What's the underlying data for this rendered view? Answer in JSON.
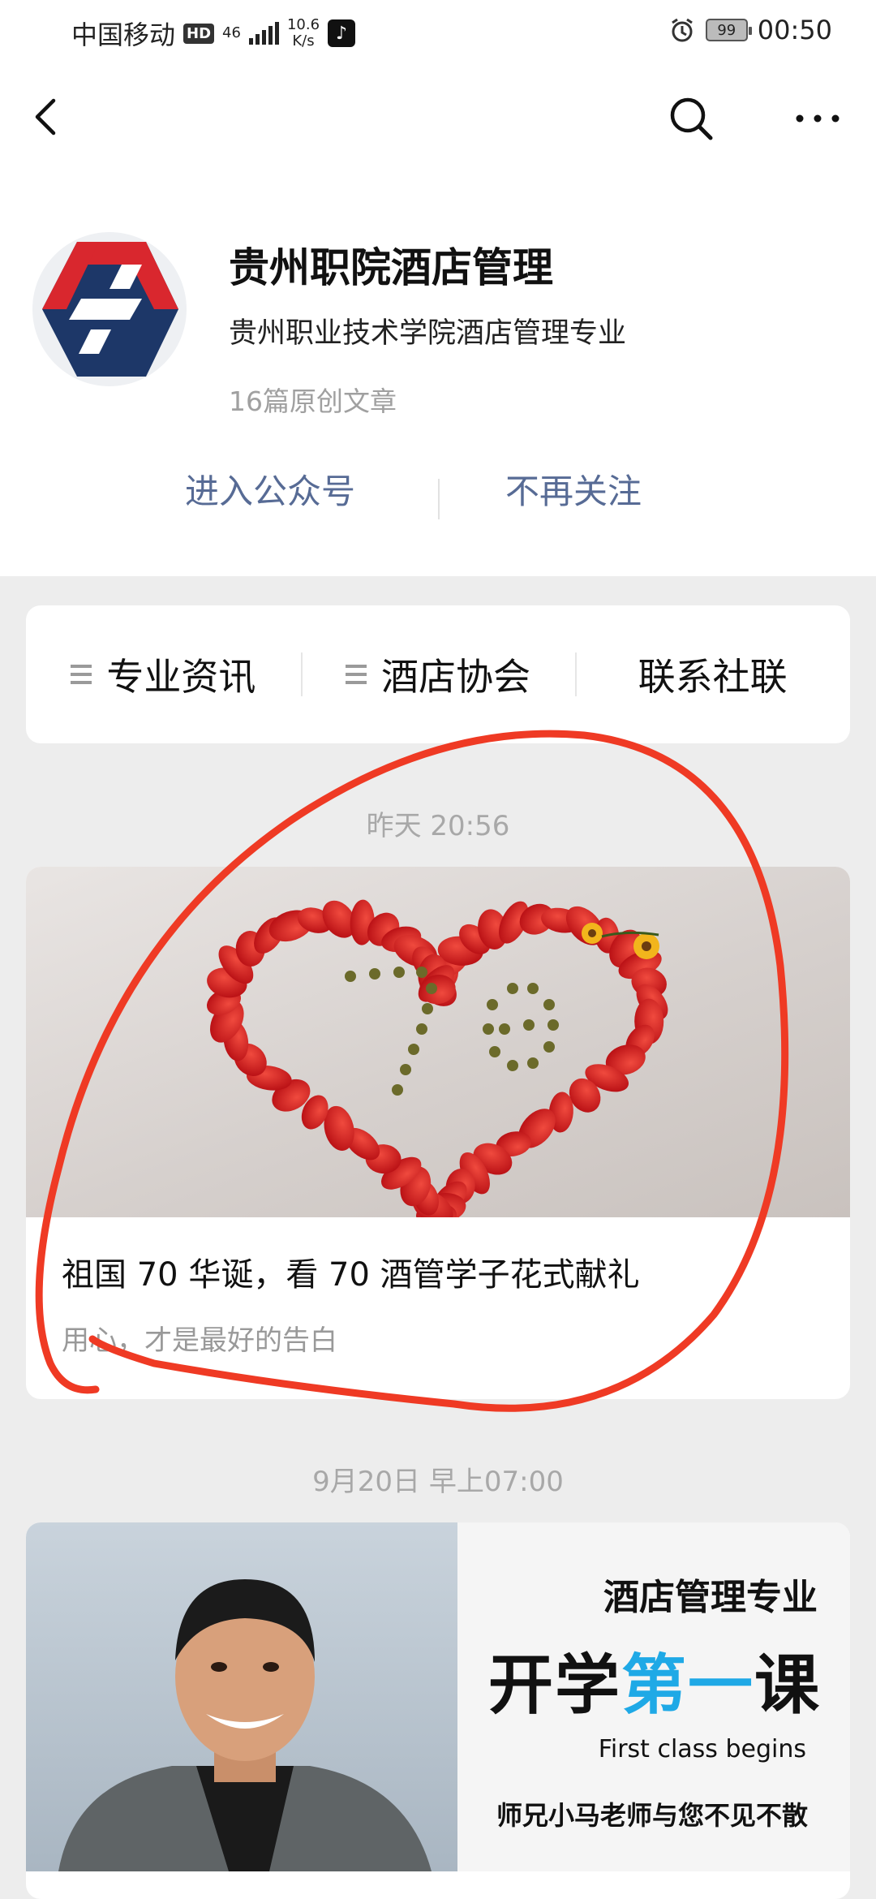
{
  "status": {
    "carrier": "中国移动",
    "hd": "HD",
    "net_type": "46",
    "speed_value": "10.6",
    "speed_unit": "K/s",
    "battery": "99",
    "time": "00:50",
    "icons": [
      "hd-icon",
      "signal-icon",
      "tiktok-icon",
      "alarm-icon",
      "battery-icon"
    ]
  },
  "nav": {
    "icons": [
      "back-arrow-icon",
      "search-icon",
      "more-icon"
    ]
  },
  "profile": {
    "name": "贵州职院酒店管理",
    "description": "贵州职业技术学院酒店管理专业",
    "article_count": "16篇原创文章",
    "enter_label": "进入公众号",
    "unfollow_label": "不再关注",
    "logo_colors": {
      "red": "#d9272e",
      "navy": "#1d3768"
    }
  },
  "menu": {
    "items": [
      {
        "label": "专业资讯",
        "has_list_icon": true
      },
      {
        "label": "酒店协会",
        "has_list_icon": true
      },
      {
        "label": "联系社联",
        "has_list_icon": false
      }
    ]
  },
  "feed": [
    {
      "timestamp": "昨天 20:56",
      "title": "祖国 70 华诞，看 70 酒管学子花式献礼",
      "subtitle": "用心，才是最好的告白",
      "cover_text": "70"
    },
    {
      "timestamp": "9月20日 早上07:00",
      "cover_heading": "酒店管理专业",
      "cover_title_part1": "开学",
      "cover_title_accent": "第一",
      "cover_title_part2": "课",
      "cover_english": "First class begins",
      "cover_footer": "师兄小马老师与您不见不散",
      "accent_color": "#1fa9e6"
    }
  ],
  "annotation": {
    "color": "#ef3a24"
  }
}
